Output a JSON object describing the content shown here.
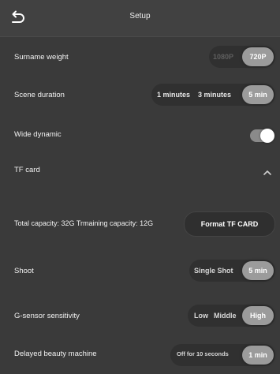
{
  "header": {
    "title": "Setup"
  },
  "rows": {
    "surname_weight": {
      "label": "Surname weight",
      "options": [
        "1080P",
        "720P"
      ],
      "selected": "720P"
    },
    "scene_duration": {
      "label": "Scene duration",
      "options": [
        "1 minutes",
        "3 minutes",
        "5 min"
      ],
      "selected": "5 min"
    },
    "wide_dynamic": {
      "label": "Wide dynamic",
      "on": true
    },
    "tf_card": {
      "label": "TF card",
      "expanded": true
    },
    "capacity": {
      "text": "Total capacity: 32G   Trmaining capacity: 12G",
      "button": "Format TF CARD"
    },
    "shoot": {
      "label": "Shoot",
      "options": [
        "Single Shot",
        "5 min"
      ],
      "selected": "5 min"
    },
    "gsensor": {
      "label": "G-sensor sensitivity",
      "options": [
        "Low",
        "Middle",
        "High"
      ],
      "selected": "High"
    },
    "delayed": {
      "label": "Delayed beauty machine",
      "options": [
        "Off for 10 seconds",
        "1 min"
      ],
      "selected": "1 min"
    }
  },
  "icons": {
    "back": "back-arrow-icon",
    "collapse": "chevron-up-icon"
  },
  "colors": {
    "background": "#3a3a3a",
    "selected_pill": "#9b9b9b",
    "toggle_on": "#8a8a8a"
  }
}
